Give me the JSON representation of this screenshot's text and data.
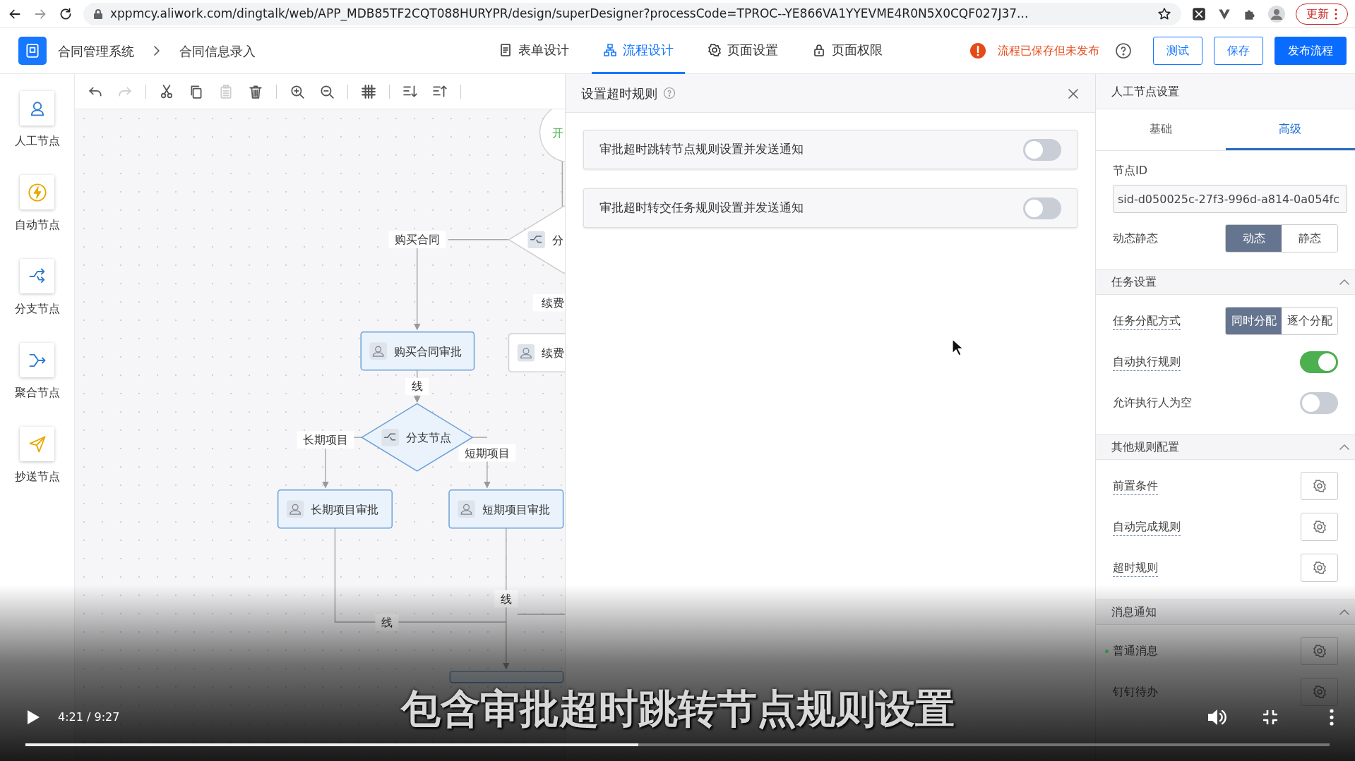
{
  "browser": {
    "url": "xppmcy.aliwork.com/dingtalk/web/APP_MDB85TF2CQT088HURYPR/design/superDesigner?processCode=TPROC--YE866VA1YYEVME4R0N5X0CQF027J37...",
    "update_button": "更新"
  },
  "app_header": {
    "breadcrumb": [
      "合同管理系统",
      "合同信息录入"
    ],
    "tabs": [
      {
        "label": "表单设计",
        "kind": "form",
        "selected": false
      },
      {
        "label": "流程设计",
        "kind": "flow",
        "selected": true
      },
      {
        "label": "页面设置",
        "kind": "settings",
        "selected": false
      },
      {
        "label": "页面权限",
        "kind": "lock",
        "selected": false
      }
    ],
    "status": "流程已保存但未发布",
    "buttons": [
      {
        "label": "测试",
        "kind": "outline"
      },
      {
        "label": "保存",
        "kind": "outline"
      },
      {
        "label": "发布流程",
        "kind": "primary"
      }
    ]
  },
  "node_palette": [
    {
      "label": "人工节点",
      "kind": "manual"
    },
    {
      "label": "自动节点",
      "kind": "auto"
    },
    {
      "label": "分支节点",
      "kind": "branch"
    },
    {
      "label": "聚合节点",
      "kind": "merge"
    },
    {
      "label": "抄送节点",
      "kind": "cc"
    }
  ],
  "toolbar": [
    {
      "kind": "undo",
      "disabled": false
    },
    {
      "kind": "redo",
      "disabled": true
    },
    {
      "kind": "cut",
      "disabled": false
    },
    {
      "kind": "copy",
      "disabled": false
    },
    {
      "kind": "paste",
      "disabled": true
    },
    {
      "kind": "delete",
      "disabled": false
    },
    {
      "kind": "zoom-in",
      "disabled": false
    },
    {
      "kind": "zoom-out",
      "disabled": false
    },
    {
      "kind": "grid",
      "disabled": false
    },
    {
      "kind": "sort-down",
      "disabled": false
    },
    {
      "kind": "sort-up",
      "disabled": false
    }
  ],
  "diagram": {
    "nodes": [
      {
        "kind": "start",
        "label": "开"
      },
      {
        "kind": "branch",
        "label": "分"
      },
      {
        "kind": "task",
        "label": "购买合同审批",
        "highlighted": true
      },
      {
        "kind": "task",
        "label": "续费",
        "highlighted": false
      },
      {
        "kind": "branch",
        "label": "分支节点"
      },
      {
        "kind": "task",
        "label": "长期项目审批",
        "highlighted": true
      },
      {
        "kind": "task",
        "label": "短期项目审批",
        "highlighted": true
      },
      {
        "kind": "task",
        "highlighted": true
      }
    ],
    "edge_labels": [
      "购买合同",
      "续费",
      "线",
      "长期项目",
      "短期项目",
      "线",
      "线"
    ]
  },
  "dialog": {
    "title": "设置超时规则",
    "rules": [
      {
        "label": "审批超时跳转节点规则设置并发送通知",
        "on": false
      },
      {
        "label": "审批超时转交任务规则设置并发送通知",
        "on": false
      }
    ]
  },
  "settings_panel": {
    "title": "人工节点设置",
    "tabs": [
      {
        "label": "基础",
        "selected": false
      },
      {
        "label": "高级",
        "selected": true
      }
    ],
    "node_id_label": "节点ID",
    "node_id_value": "sid-d050025c-27f3-996d-a814-0a054fc",
    "mode": {
      "label": "动态静态",
      "options": [
        {
          "label": "动态",
          "selected": true
        },
        {
          "label": "静态",
          "selected": false
        }
      ]
    },
    "sections": [
      {
        "title": "任务设置",
        "expanded": true,
        "rows": [
          {
            "kind": "segmented",
            "label": "任务分配方式",
            "hint": true,
            "options": [
              {
                "label": "同时分配",
                "selected": true
              },
              {
                "label": "逐个分配",
                "selected": false
              }
            ]
          },
          {
            "kind": "switch",
            "label": "自动执行规则",
            "hint": true,
            "on": true
          },
          {
            "kind": "switch",
            "label": "允许执行人为空",
            "hint": false,
            "on": false
          }
        ]
      },
      {
        "title": "其他规则配置",
        "expanded": true,
        "rows": [
          {
            "kind": "gear",
            "label": "前置条件",
            "hint": true
          },
          {
            "kind": "gear",
            "label": "自动完成规则",
            "hint": true
          },
          {
            "kind": "gear",
            "label": "超时规则",
            "hint": true
          }
        ]
      },
      {
        "title": "消息通知",
        "expanded": true,
        "rows": [
          {
            "kind": "gear",
            "label": "普通消息",
            "hint": false,
            "color": "#3d8b40"
          },
          {
            "kind": "gear",
            "label": "钉钉待办",
            "hint": false
          }
        ]
      }
    ]
  },
  "video": {
    "subtitle": "包含审批超时跳转节点规则设置",
    "time": "4:21 / 9:27",
    "progress": {
      "level": 0.47
    }
  }
}
